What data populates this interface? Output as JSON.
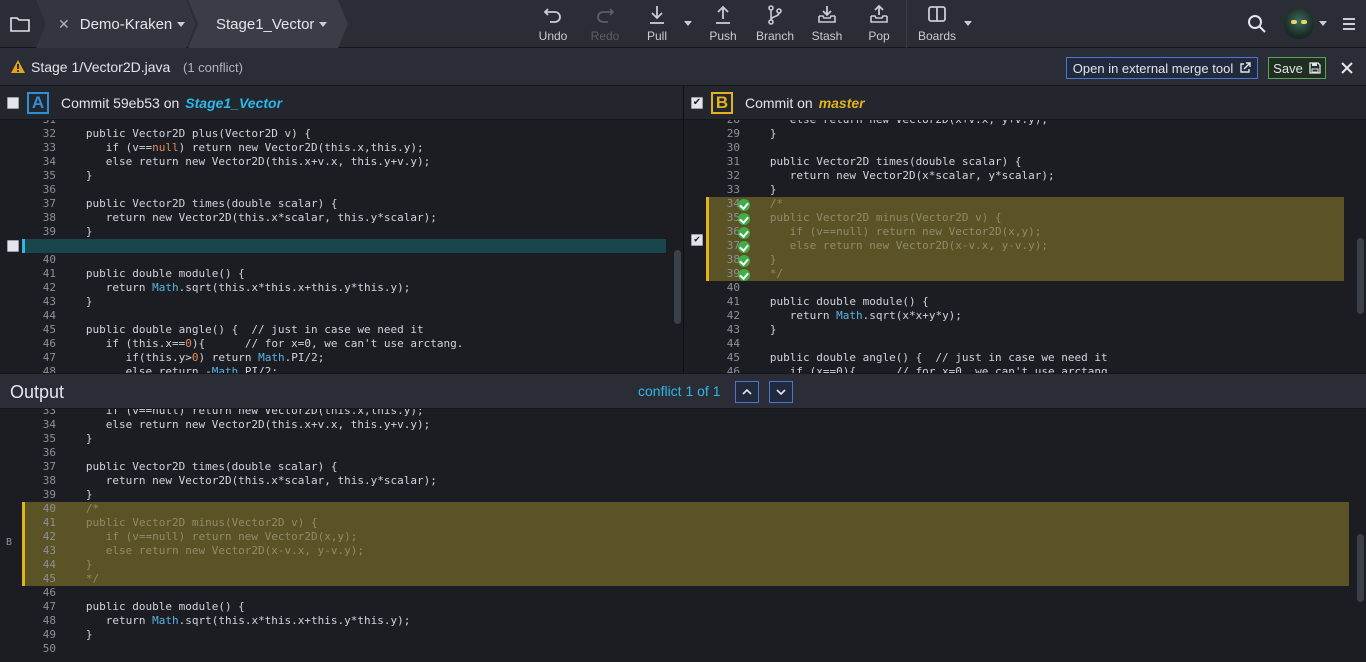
{
  "toolbar": {
    "repo": "Demo-Kraken",
    "branch": "Stage1_Vector",
    "tools": [
      {
        "label": "Undo",
        "icon": "undo-icon"
      },
      {
        "label": "Redo",
        "icon": "redo-icon"
      },
      {
        "label": "Pull",
        "icon": "pull-icon"
      },
      {
        "label": "Push",
        "icon": "push-icon"
      },
      {
        "label": "Branch",
        "icon": "branch-icon"
      },
      {
        "label": "Stash",
        "icon": "stash-icon"
      },
      {
        "label": "Pop",
        "icon": "pop-icon"
      },
      {
        "label": "Boards",
        "icon": "boards-icon"
      }
    ]
  },
  "file_bar": {
    "title": "Stage 1/Vector2D.java",
    "subtitle": "(1 conflict)",
    "external_label": "Open in external merge tool",
    "save_label": "Save"
  },
  "pane_a": {
    "badge": "A",
    "label": "Commit 59eb53 on",
    "branch": "Stage1_Vector"
  },
  "pane_b": {
    "badge": "B",
    "label": "Commit on",
    "branch": "master"
  },
  "output": {
    "title": "Output",
    "conflict_count": "conflict 1 of 1",
    "marker": "B"
  }
}
